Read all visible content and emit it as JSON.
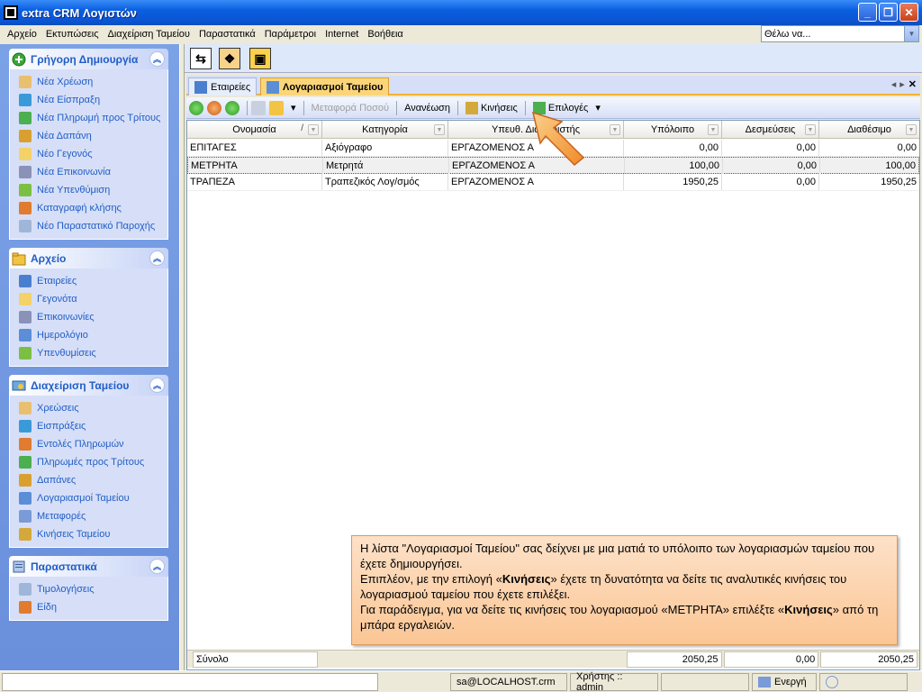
{
  "window": {
    "title": "extra CRM Λογιστών"
  },
  "menu": [
    "Αρχείο",
    "Εκτυπώσεις",
    "Διαχείριση Ταμείου",
    "Παραστατικά",
    "Παράμετροι",
    "Internet",
    "Βοήθεια"
  ],
  "search": {
    "value": "Θέλω να..."
  },
  "sidebar": {
    "groups": [
      {
        "title": "Γρήγορη Δημιουργία",
        "icon": "plus-icon",
        "items": [
          "Νέα Χρέωση",
          "Νέα Είσπραξη",
          "Νέα Πληρωμή προς Τρίτους",
          "Νέα Δαπάνη",
          "Νέο Γεγονός",
          "Νέα Επικοινωνία",
          "Νέα Υπενθύμιση",
          "Καταγραφή κλήσης",
          "Νέο Παραστατικό Παροχής"
        ]
      },
      {
        "title": "Αρχείο",
        "icon": "folder-icon",
        "items": [
          "Εταιρείες",
          "Γεγονότα",
          "Επικοινωνίες",
          "Ημερολόγιο",
          "Υπενθυμίσεις"
        ]
      },
      {
        "title": "Διαχείριση Ταμείου",
        "icon": "cash-icon",
        "items": [
          "Χρεώσεις",
          "Εισπράξεις",
          "Εντολές Πληρωμών",
          "Πληρωμές προς Τρίτους",
          "Δαπάνες",
          "Λογαριασμοί Ταμείου",
          "Μεταφορές",
          "Κινήσεις Ταμείου"
        ]
      },
      {
        "title": "Παραστατικά",
        "icon": "document-icon",
        "items": [
          "Τιμολογήσεις",
          "Είδη"
        ]
      }
    ]
  },
  "tabs": [
    {
      "label": "Εταιρείες"
    },
    {
      "label": "Λογαριασμοί Ταμείου"
    }
  ],
  "toolbar": {
    "transfer_label": "Μεταφορά Ποσού",
    "refresh_label": "Ανανέωση",
    "movements_label": "Κινήσεις",
    "options_label": "Επιλογές"
  },
  "grid": {
    "columns": [
      "Ονομασία",
      "Κατηγορία",
      "Υπευθ. Διαχειριστής",
      "Υπόλοιπο",
      "Δεσμεύσεις",
      "Διαθέσιμο"
    ],
    "rows": [
      {
        "name": "ΕΠΙΤΑΓΕΣ",
        "category": "Αξιόγραφο",
        "manager": "ΕΡΓΑΖΟΜΕΝΟΣ Α",
        "balance": "0,00",
        "commitments": "0,00",
        "available": "0,00"
      },
      {
        "name": "ΜΕΤΡΗΤΑ",
        "category": "Μετρητά",
        "manager": "ΕΡΓΑΖΟΜΕΝΟΣ Α",
        "balance": "100,00",
        "commitments": "0,00",
        "available": "100,00"
      },
      {
        "name": "ΤΡΑΠΕΖΑ",
        "category": "Τραπεζικός Λογ/σμός",
        "manager": "ΕΡΓΑΖΟΜΕΝΟΣ Α",
        "balance": "1950,25",
        "commitments": "0,00",
        "available": "1950,25"
      }
    ],
    "footer": {
      "label": "Σύνολο",
      "balance": "2050,25",
      "commitments": "0,00",
      "available": "2050,25"
    }
  },
  "callout": {
    "line1": "Η λίστα \"Λογαριασμοί Ταμείου\" σας δείχνει με μια ματιά το υπόλοιπο των λογαριασμών ταμείου που έχετε δημιουργήσει.",
    "line2_pre": "Επιπλέον, με την επιλογή «",
    "line2_bold": "Κινήσεις",
    "line2_post": "» έχετε τη δυνατότητα να δείτε τις αναλυτικές κινήσεις του λογαριασμού ταμείου που έχετε επιλέξει.",
    "line3_pre": "Για παράδειγμα, για να δείτε τις κινήσεις του λογαριασμού «ΜΕΤΡΗΤΑ» επιλέξτε «",
    "line3_bold": "Κινήσεις",
    "line3_post": "» από τη μπάρα εργαλειών."
  },
  "status": {
    "server": "sa@LOCALHOST.crm",
    "user": "Χρήστης :: admin",
    "state": "Ενεργή"
  }
}
